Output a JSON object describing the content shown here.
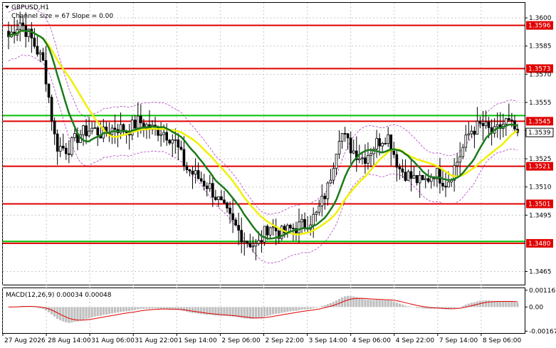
{
  "header": {
    "symbol": "GBPUSD,H1",
    "indicator": "Channel size = 67 Slope = 0.00"
  },
  "macd_label": "MACD(12,26,9) 0.00034 0.00048",
  "colors": {
    "candle": "#000000",
    "level_red": "#e00000",
    "level_green": "#00c000",
    "ma_fast": "#1a7a1a",
    "ma_slow": "#f0f000",
    "bands": "#b040c0",
    "macd_hist": "#c0c0c0",
    "macd_signal": "#e00000",
    "grid": "#c8c8c8"
  },
  "chart_data": {
    "type": "candlestick",
    "symbol": "GBPUSD",
    "timeframe": "H1",
    "y_ticks": [
      "1.3600",
      "1.3585",
      "1.3570",
      "1.3555",
      "1.3540",
      "1.3525",
      "1.3510",
      "1.3495",
      "1.3465"
    ],
    "ylim": [
      1.3458,
      1.3608
    ],
    "x_tick_labels": [
      "27 Aug 2026",
      "28 Aug 14:00",
      "31 Aug 06:00",
      "31 Aug 22:00",
      "1 Sep 14:00",
      "2 Sep 06:00",
      "2 Sep 22:00",
      "3 Sep 14:00",
      "4 Sep 06:00",
      "4 Sep 22:00",
      "7 Sep 14:00",
      "8 Sep 06:00"
    ],
    "horizontal_levels": [
      {
        "value": 1.3596,
        "label": "1.3596",
        "color": "red"
      },
      {
        "value": 1.3573,
        "label": "1.3573",
        "color": "red"
      },
      {
        "value": 1.3548,
        "label": "",
        "color": "green"
      },
      {
        "value": 1.3545,
        "label": "1.3545",
        "color": "red"
      },
      {
        "value": 1.3521,
        "label": "1.3521",
        "color": "red"
      },
      {
        "value": 1.3501,
        "label": "1.3501",
        "color": "red"
      },
      {
        "value": 1.3481,
        "label": "",
        "color": "green"
      },
      {
        "value": 1.348,
        "label": "1.3480",
        "color": "red"
      }
    ],
    "current_price": "1.3539",
    "close_keys": [
      1.359,
      1.3598,
      1.3588,
      1.3575,
      1.3532,
      1.353,
      1.3538,
      1.3541,
      1.3538,
      1.3542,
      1.354,
      1.3545,
      1.3541,
      1.354,
      1.3535,
      1.352,
      1.3515,
      1.351,
      1.35,
      1.349,
      1.3482,
      1.3478,
      1.349,
      1.3485,
      1.3488,
      1.349,
      1.3495,
      1.351,
      1.354,
      1.353,
      1.3525,
      1.3533,
      1.3538,
      1.352,
      1.3515,
      1.3512,
      1.3518,
      1.3512,
      1.3525,
      1.354,
      1.3543,
      1.3538,
      1.3545,
      1.3539
    ],
    "macd": {
      "params": "12,26,9",
      "value": 0.00034,
      "signal": 0.00048,
      "y_ticks": [
        "0.00116",
        "0.00",
        "-0.00167"
      ],
      "ylim": [
        -0.0018,
        0.0013
      ]
    }
  }
}
